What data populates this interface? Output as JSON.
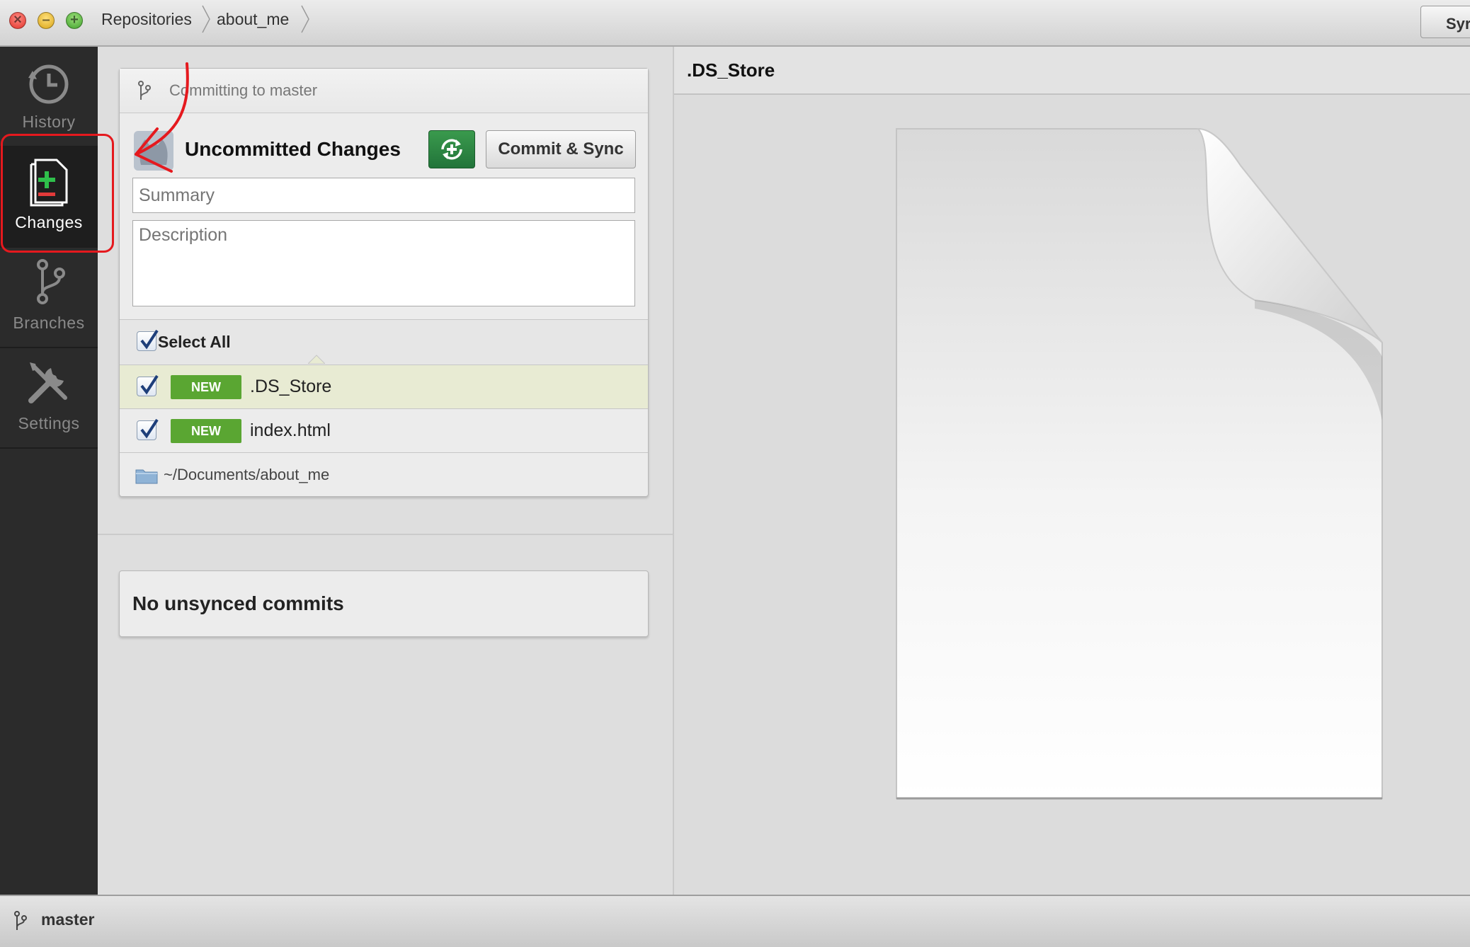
{
  "window": {
    "breadcrumbs": [
      "Repositories",
      "about_me"
    ],
    "sync_button_label": "Syr"
  },
  "sidebar": {
    "items": [
      {
        "label": "History",
        "icon": "history-icon"
      },
      {
        "label": "Changes",
        "icon": "changes-icon",
        "active": true
      },
      {
        "label": "Branches",
        "icon": "branches-icon"
      },
      {
        "label": "Settings",
        "icon": "settings-icon"
      }
    ]
  },
  "commit_panel": {
    "committing_to": "Committing to master",
    "title": "Uncommitted Changes",
    "commit_button": "Commit & Sync",
    "summary_placeholder": "Summary",
    "description_placeholder": "Description",
    "select_all_label": "Select All",
    "files": [
      {
        "badge": "NEW",
        "name": ".DS_Store",
        "checked": true,
        "selected": true
      },
      {
        "badge": "NEW",
        "name": "index.html",
        "checked": true,
        "selected": false
      }
    ],
    "repo_path": "~/Documents/about_me"
  },
  "unsynced": {
    "message": "No unsynced commits"
  },
  "preview": {
    "title": ".DS_Store"
  },
  "statusbar": {
    "branch": "master"
  },
  "colors": {
    "accent_green": "#2f8a45",
    "badge_green": "#5aa632",
    "annotation_red": "#e5191e",
    "sidebar_bg": "#2b2b2b"
  }
}
